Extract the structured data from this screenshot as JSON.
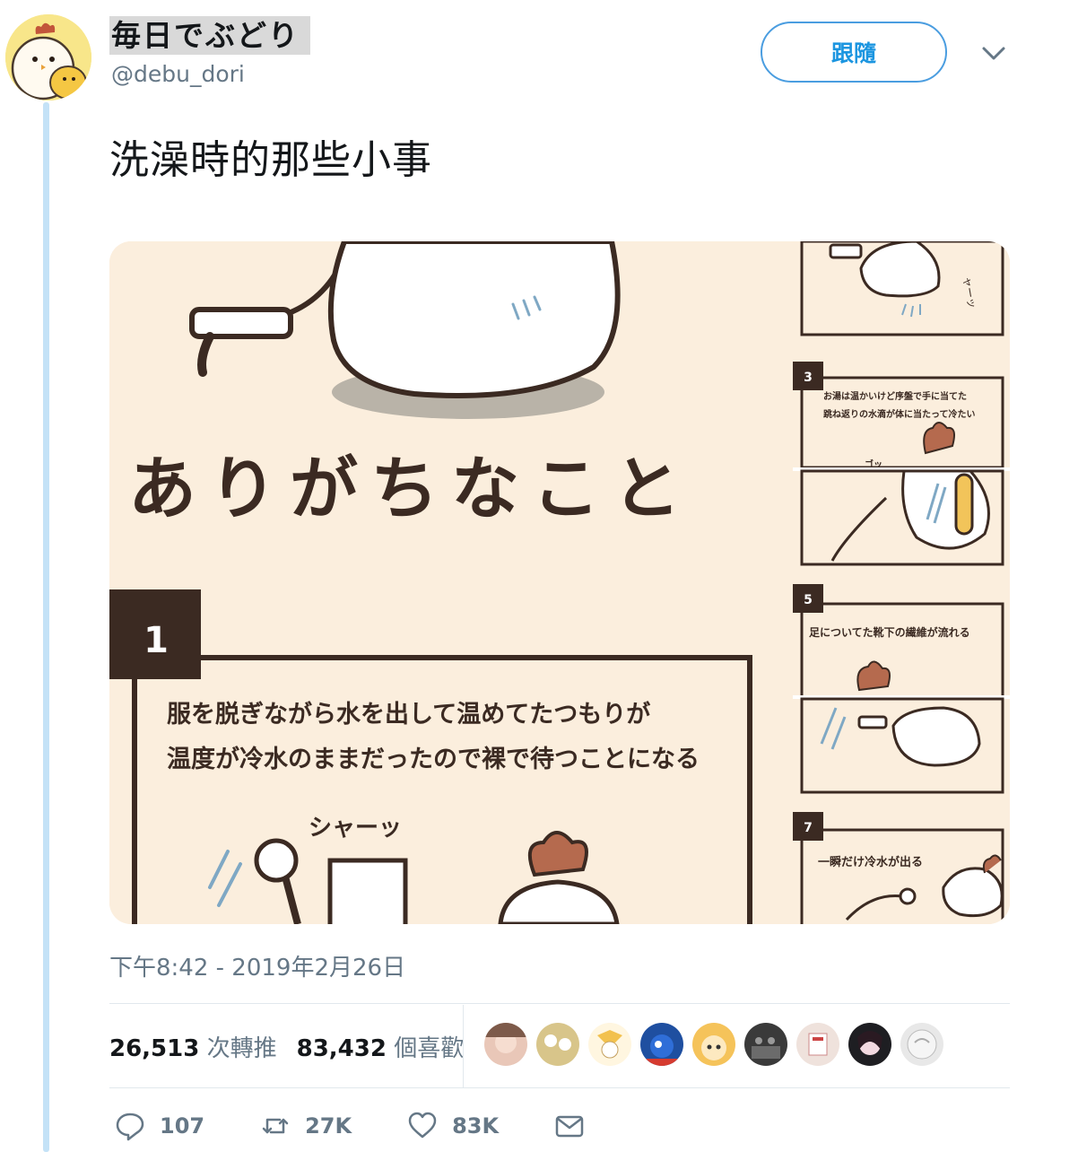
{
  "author": {
    "display_name": "毎日でぶどり",
    "handle": "@debu_dori"
  },
  "follow_label": "跟隨",
  "tweet": {
    "text": "洗澡時的那些小事",
    "timestamp": "下午8:42 - 2019年2月26日"
  },
  "media": {
    "title": "ありがちなこと",
    "panel1": {
      "number": "1",
      "line1": "服を脱ぎながら水を出して温めてたつもりが",
      "line2": "温度が冷水のままだったので裸で待つことになる",
      "sfx": "シャーッ"
    },
    "panel2": {
      "sfx": "ャーッ"
    },
    "panel3": {
      "number": "3",
      "line1": "お湯は温かいけど序盤で手に当てた",
      "line2": "跳ね返りの水滴が体に当たって冷たい",
      "sfx": "ゴッ"
    },
    "panel5": {
      "number": "5",
      "line1": "足についてた靴下の繊維が流れる"
    },
    "panel7": {
      "number": "7",
      "line1": "一瞬だけ冷水が出る"
    },
    "colors": {
      "cream": "#fbeedd",
      "dark_brown": "#3b2a22",
      "comb": "#b56a4e"
    }
  },
  "stats": {
    "retweets": "26,513",
    "retweets_label": "次轉推",
    "likes": "83,432",
    "likes_label": "個喜歡"
  },
  "actions": {
    "replies": "107",
    "retweets": "27K",
    "likes": "83K"
  },
  "icons": [
    "chevron-down-icon",
    "reply-icon",
    "retweet-icon",
    "heart-icon",
    "mail-icon"
  ]
}
